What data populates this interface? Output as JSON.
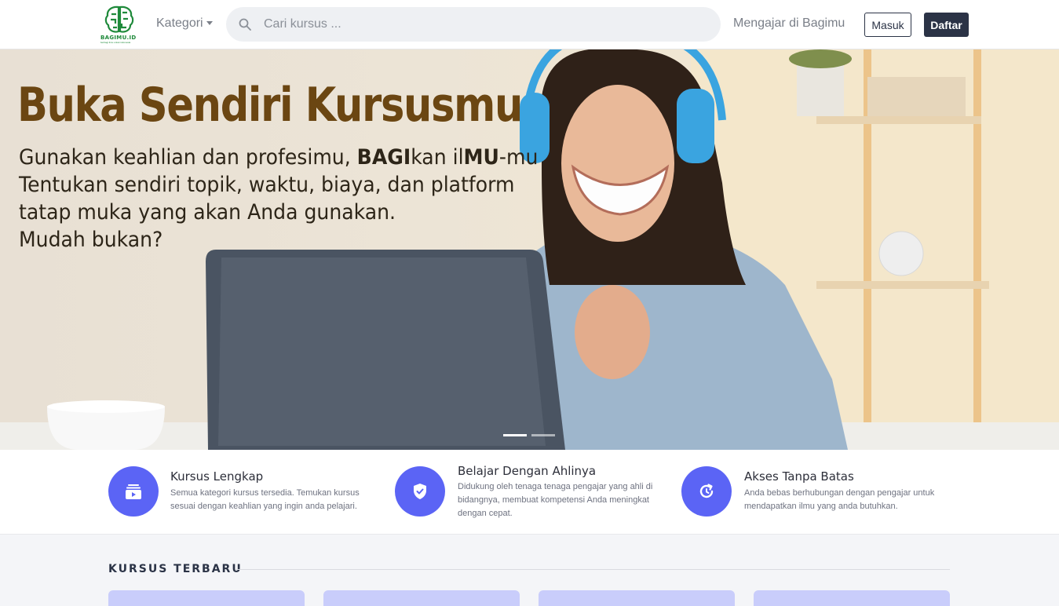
{
  "nav": {
    "logo_text": "BAGIMU.ID",
    "logo_tagline": "berbagi ilmu untuk indonesia",
    "kategori_label": "Kategori",
    "search_placeholder": "Cari kursus ...",
    "mengajar_label": "Mengajar di Bagimu",
    "masuk_label": "Masuk",
    "daftar_label": "Daftar"
  },
  "hero": {
    "title": "Buka Sendiri Kursusmu",
    "line1_a": "Gunakan keahlian dan profesimu, ",
    "line1_b": "BAGI",
    "line1_c": "kan il",
    "line1_d": "MU",
    "line1_e": "-mu",
    "line2": "Tentukan sendiri topik, waktu, biaya, dan platform",
    "line3": "tatap muka yang akan Anda gunakan.",
    "line4": "Mudah bukan?",
    "slides_total": 2,
    "active_slide": 1
  },
  "features": [
    {
      "title": "Kursus Lengkap",
      "description": "Semua kategori kursus tersedia. Temukan kursus sesuai dengan keahlian yang ingin anda pelajari.",
      "icon": "course-stack-icon"
    },
    {
      "title": "Belajar Dengan Ahlinya",
      "description": "Didukung oleh tenaga tenaga pengajar yang ahli di bidangnya, membuat kompetensi Anda meningkat dengan cepat.",
      "icon": "shield-check-icon"
    },
    {
      "title": "Akses Tanpa Batas",
      "description": "Anda bebas berhubungan dengan pengajar untuk mendapatkan ilmu yang anda butuhkan.",
      "icon": "refresh-clock-icon"
    }
  ],
  "section": {
    "title": "KURSUS TERBARU"
  },
  "colors": {
    "brand_dark": "#2b3346",
    "accent": "#5b64f5",
    "hero_title": "#6b4612",
    "logo_green": "#1f8a3b"
  }
}
